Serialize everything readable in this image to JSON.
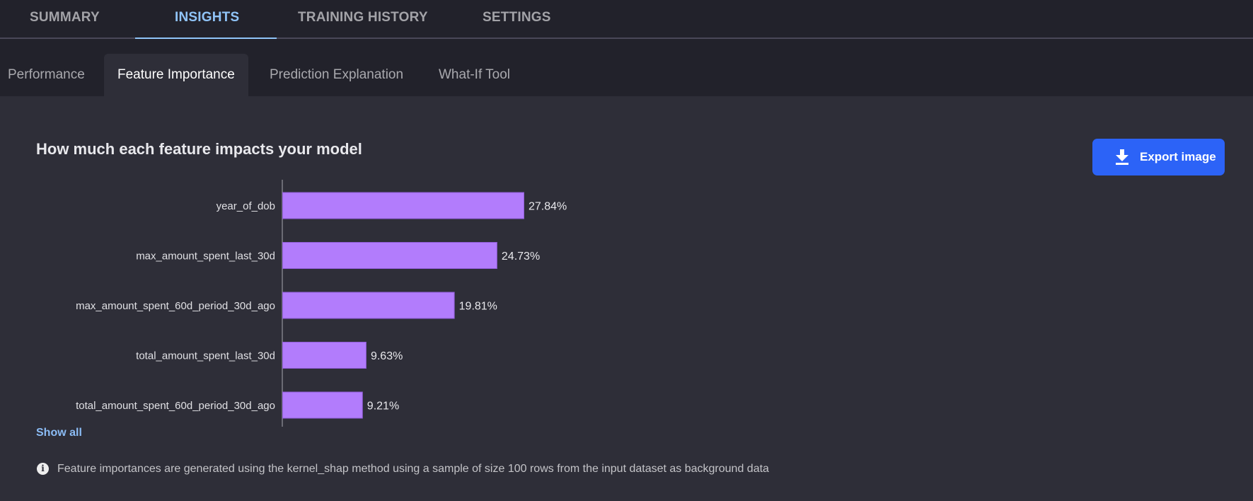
{
  "top_tabs": [
    {
      "label": "SUMMARY",
      "active": false
    },
    {
      "label": "INSIGHTS",
      "active": true
    },
    {
      "label": "TRAINING HISTORY",
      "active": false
    },
    {
      "label": "SETTINGS",
      "active": false
    }
  ],
  "sub_tabs": [
    {
      "label": "Performance",
      "active": false
    },
    {
      "label": "Feature Importance",
      "active": true
    },
    {
      "label": "Prediction Explanation",
      "active": false
    },
    {
      "label": "What-If Tool",
      "active": false
    }
  ],
  "section": {
    "title": "How much each feature impacts your model",
    "export_button": {
      "label": "Export image",
      "icon": "download-icon"
    },
    "show_all_label": "Show all",
    "info": {
      "icon": "info-icon",
      "text": "Feature importances are generated using the kernel_shap method using a sample of size 100 rows from the input dataset as background data"
    }
  },
  "colors": {
    "accent": "#90c4f8",
    "bar": "#b27cfc",
    "bar_border": "#8f5cd6",
    "button": "#2c63f7"
  },
  "chart_data": {
    "type": "bar",
    "orientation": "horizontal",
    "title": "How much each feature impacts your model",
    "xlabel": "",
    "ylabel": "",
    "categories": [
      "year_of_dob",
      "max_amount_spent_last_30d",
      "max_amount_spent_60d_period_30d_ago",
      "total_amount_spent_last_30d",
      "total_amount_spent_60d_period_30d_ago"
    ],
    "values": [
      27.84,
      24.73,
      19.81,
      9.63,
      9.21
    ],
    "value_labels": [
      "27.84%",
      "24.73%",
      "19.81%",
      "9.63%",
      "9.21%"
    ],
    "unit": "%",
    "xlim": [
      0,
      100
    ],
    "grid": false,
    "legend": "none"
  }
}
